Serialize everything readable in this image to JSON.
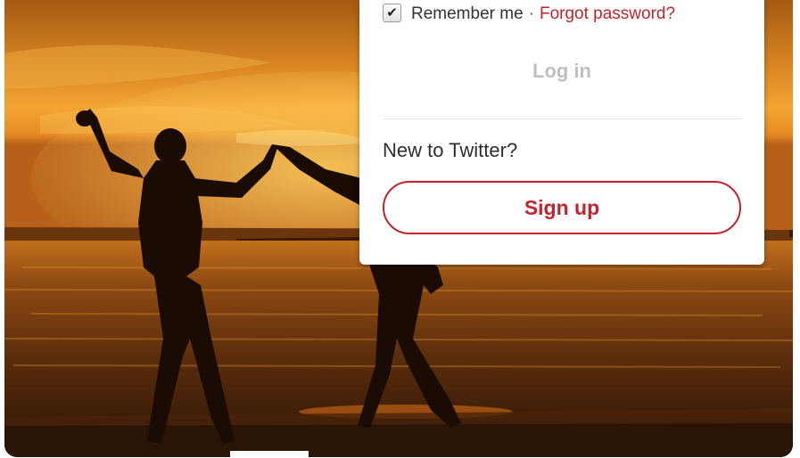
{
  "login_card": {
    "remember_label": "Remember me",
    "separator": "·",
    "forgot_password": "Forgot password?",
    "remember_checked": true,
    "login_button": "Log in",
    "new_prompt": "New to Twitter?",
    "signup_button": "Sign up"
  },
  "colors": {
    "accent": "#c4232d",
    "disabled_text": "#bfbfbf",
    "sky_top": "#b06414",
    "sky_glow": "#f2a02a",
    "sea": "#3b1e08"
  }
}
